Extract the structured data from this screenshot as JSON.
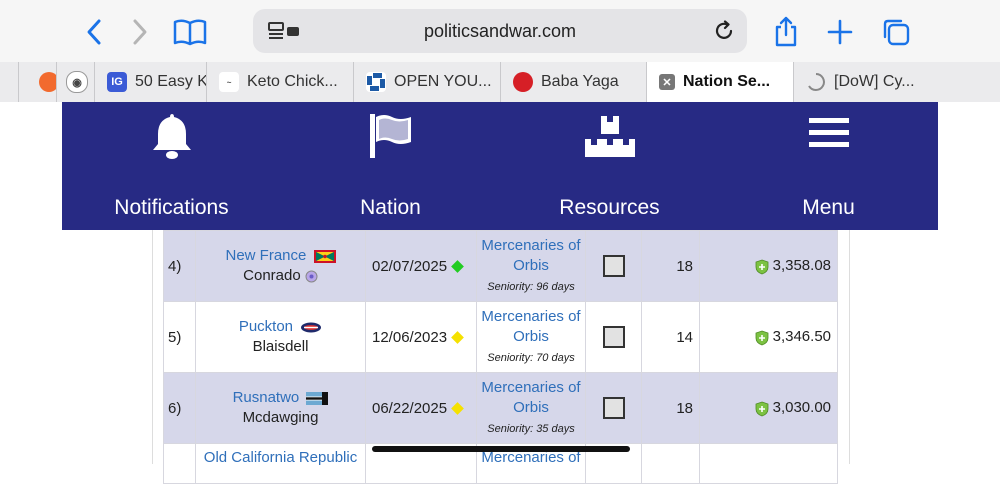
{
  "browser": {
    "url": "politicsandwar.com",
    "tabs": [
      {
        "label": "",
        "favicon": "orange-circle-icon"
      },
      {
        "label": "",
        "favicon": "podcast-icon"
      },
      {
        "label": "50 Easy K",
        "favicon": "ig-icon"
      },
      {
        "label": "Keto Chick...",
        "favicon": "recipe-logo-icon"
      },
      {
        "label": "OPEN YOU...",
        "favicon": "chase-logo-icon"
      },
      {
        "label": "Baba Yaga",
        "favicon": "red-circle-icon"
      },
      {
        "label": "Nation Se...",
        "favicon": "close-icon",
        "active": true
      },
      {
        "label": "[DoW] Cy...",
        "favicon": "loading-icon"
      }
    ]
  },
  "nav": {
    "items": [
      {
        "label": "Notifications",
        "icon": "bell-icon"
      },
      {
        "label": "Nation",
        "icon": "flag-icon"
      },
      {
        "label": "Resources",
        "icon": "boxes-icon"
      },
      {
        "label": "Menu",
        "icon": "hamburger-icon"
      }
    ]
  },
  "table": {
    "rows": [
      {
        "rank": "4)",
        "nation": "New France",
        "leader": "Conrado",
        "date": "02/07/2025",
        "activity_color": "#22cc22",
        "alliance_line1": "Mercenaries of",
        "alliance_line2": "Orbis",
        "seniority": "Seniority: 96 days",
        "cities": "18",
        "score": "3,358.08"
      },
      {
        "rank": "5)",
        "nation": "Puckton",
        "leader": "Blaisdell",
        "date": "12/06/2023",
        "activity_color": "#f5e100",
        "alliance_line1": "Mercenaries of",
        "alliance_line2": "Orbis",
        "seniority": "Seniority: 70 days",
        "cities": "14",
        "score": "3,346.50"
      },
      {
        "rank": "6)",
        "nation": "Rusnatwo",
        "leader": "Mcdawging",
        "date": "06/22/2025",
        "activity_color": "#f5e100",
        "alliance_line1": "Mercenaries of",
        "alliance_line2": "Orbis",
        "seniority": "Seniority: 35 days",
        "cities": "18",
        "score": "3,030.00"
      },
      {
        "rank": "",
        "nation": "Old California Republic",
        "leader": "",
        "date": "",
        "activity_color": "",
        "alliance_line1": "Mercenaries of",
        "alliance_line2": "",
        "seniority": "",
        "cities": "",
        "score": ""
      }
    ]
  },
  "colors": {
    "nav_bg": "#272a84",
    "alt_row": "#d6d7ea",
    "link": "#2f6fba",
    "accent": "#1a73e8"
  }
}
